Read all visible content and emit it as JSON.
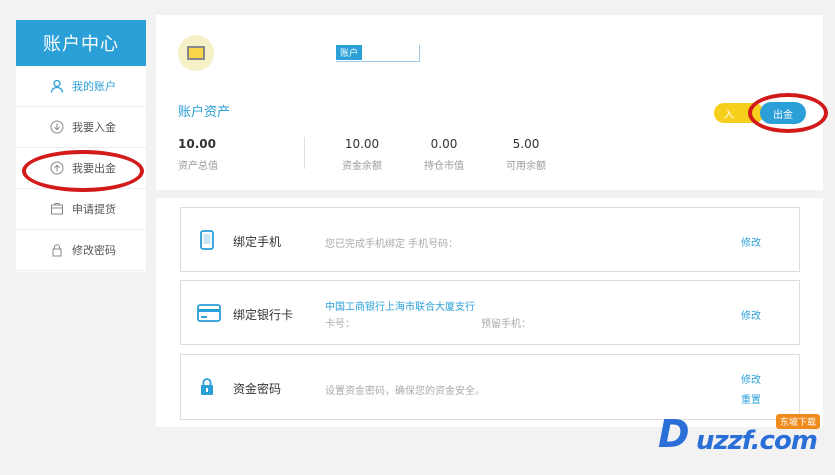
{
  "sidebar": {
    "title": "账户中心",
    "items": [
      {
        "label": "我的账户"
      },
      {
        "label": "我要入金"
      },
      {
        "label": "我要出金"
      },
      {
        "label": "申请提货"
      },
      {
        "label": "修改密码"
      }
    ]
  },
  "header": {
    "tag": "账户"
  },
  "assets": {
    "title": "账户资产",
    "in_button": "入",
    "out_button": "出金",
    "stats": [
      {
        "value": "10.00",
        "label": "资产总值"
      },
      {
        "value": "10.00",
        "label": "资金余额"
      },
      {
        "value": "0.00",
        "label": "持仓市值"
      },
      {
        "value": "5.00",
        "label": "可用余额"
      }
    ]
  },
  "cards": {
    "phone": {
      "title": "绑定手机",
      "desc": "您已完成手机绑定 手机号码：",
      "link": "修改"
    },
    "bank": {
      "title": "绑定银行卡",
      "bank_name": "中国工商银行上海市联合大厦支行",
      "card_label": "卡号：",
      "phone_label": "预留手机：",
      "link": "修改"
    },
    "password": {
      "title": "资金密码",
      "desc": "设置资金密码，确保您的资金安全。",
      "link1": "修改",
      "link2": "重置"
    }
  },
  "watermark": {
    "brand": "uzzf.com",
    "badge": "东坡下载"
  },
  "colors": {
    "accent": "#2a9fd8",
    "highlight": "#d21a1a",
    "yellow": "#f6cf1c"
  }
}
